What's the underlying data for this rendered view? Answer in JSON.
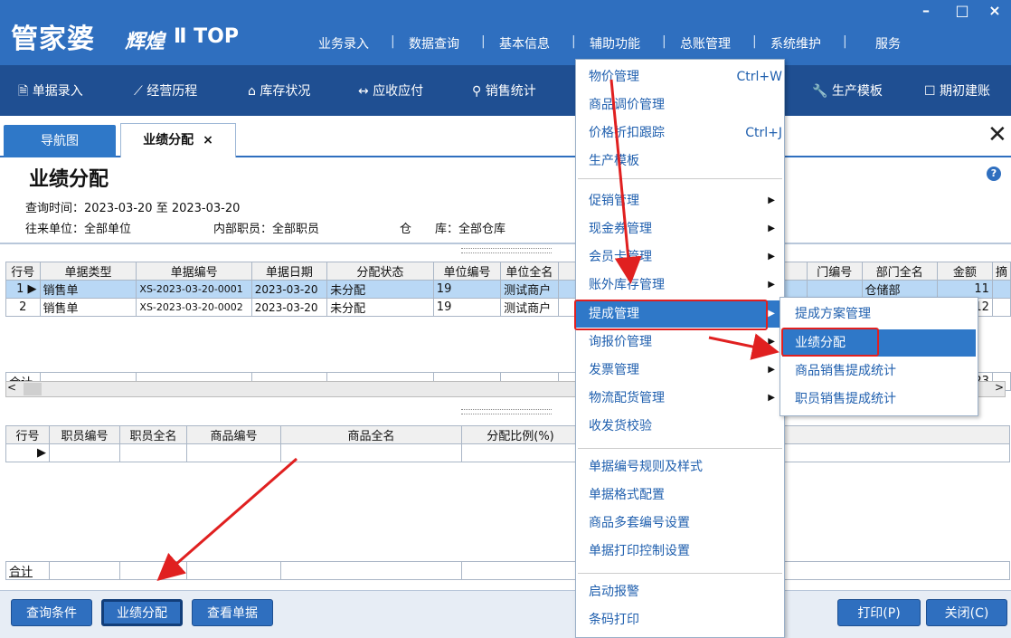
{
  "app": {
    "logo_main": "管家婆",
    "logo_sub": "辉煌",
    "logo_edition": "Ⅱ TOP",
    "menus": [
      "业务录入",
      "数据查询",
      "基本信息",
      "辅助功能",
      "总账管理",
      "系统维护",
      "服务"
    ],
    "separator": "|",
    "window_buttons": [
      "–",
      "□",
      "×"
    ]
  },
  "toolbar": {
    "items": [
      {
        "icon": "doc-entry-icon",
        "glyph": "🗎",
        "label": "单据录入"
      },
      {
        "icon": "chart-icon",
        "glyph": "⟋",
        "label": "经营历程"
      },
      {
        "icon": "home-icon",
        "glyph": "⌂",
        "label": "库存状况"
      },
      {
        "icon": "exchange-icon",
        "glyph": "↔",
        "label": "应收应付"
      },
      {
        "icon": "search-icon",
        "glyph": "⚲",
        "label": "销售统计"
      },
      {
        "icon": "wrench-icon",
        "glyph": "🔧",
        "label": "生产模板"
      },
      {
        "icon": "edit-icon",
        "glyph": "☐",
        "label": "期初建账"
      }
    ]
  },
  "tabs": {
    "nav": "导航图",
    "active": "业绩分配",
    "close": "×",
    "main_close": "✕"
  },
  "page": {
    "title": "业绩分配",
    "help": "?",
    "query_time_label": "查询时间：",
    "query_time_value": "2023-03-20 至 2023-03-20",
    "unit_label": "往来单位：",
    "unit_value": "全部单位",
    "staff_label": "内部职员：",
    "staff_value": "全部职员",
    "warehouse_label": "仓　　库：",
    "warehouse_value": "全部仓库"
  },
  "grid1": {
    "columns": [
      "行号",
      "单据类型",
      "单据编号",
      "单据日期",
      "分配状态",
      "单位编号",
      "单位全名",
      "门编号",
      "部门全名",
      "金额",
      "摘"
    ],
    "rows": [
      {
        "no": "1",
        "type": "销售单",
        "code": "XS-2023-03-20-0001",
        "date": "2023-03-20",
        "status": "未分配",
        "unit_code": "19",
        "unit_name": "测试商户",
        "dept": "仓储部",
        "amount": "11"
      },
      {
        "no": "2",
        "type": "销售单",
        "code": "XS-2023-03-20-0002",
        "date": "2023-03-20",
        "status": "未分配",
        "unit_code": "19",
        "unit_name": "测试商户",
        "dept": "",
        "amount": "12"
      }
    ],
    "sum_label": "合计",
    "sum_amount": "23"
  },
  "grid2": {
    "columns": [
      "行号",
      "职员编号",
      "职员全名",
      "商品编号",
      "商品全名",
      "分配比例(%)"
    ],
    "sum_label": "合计"
  },
  "buttons": {
    "query": "查询条件",
    "assign": "业绩分配",
    "view": "查看单据",
    "print": "打印(P)",
    "close": "关闭(C)"
  },
  "dropdown": {
    "items": [
      {
        "label": "物价管理",
        "shortcut": "Ctrl+W"
      },
      {
        "label": "商品调价管理"
      },
      {
        "label": "价格折扣跟踪",
        "shortcut": "Ctrl+J"
      },
      {
        "label": "生产模板"
      },
      {
        "label": "促销管理",
        "submenu": "▶"
      },
      {
        "label": "现金券管理",
        "submenu": "▶"
      },
      {
        "label": "会员卡管理",
        "submenu": "▶"
      },
      {
        "label": "账外库存管理",
        "submenu": "▶"
      },
      {
        "label": "提成管理",
        "submenu": "▶"
      },
      {
        "label": "询报价管理",
        "submenu": "▶"
      },
      {
        "label": "发票管理",
        "submenu": "▶"
      },
      {
        "label": "物流配货管理",
        "submenu": "▶"
      },
      {
        "label": "收发货校验"
      },
      {
        "label": "单据编号规则及样式"
      },
      {
        "label": "单据格式配置"
      },
      {
        "label": "商品多套编号设置"
      },
      {
        "label": "单据打印控制设置"
      },
      {
        "label": "启动报警"
      },
      {
        "label": "条码打印"
      }
    ]
  },
  "submenu": {
    "items": [
      "提成方案管理",
      "业绩分配",
      "商品销售提成统计",
      "职员销售提成统计"
    ]
  },
  "colors": {
    "title_bar": "#2f6fbf",
    "toolbar": "#1f4f92",
    "highlight": "#2f78c8",
    "annotation": "#e02020"
  }
}
